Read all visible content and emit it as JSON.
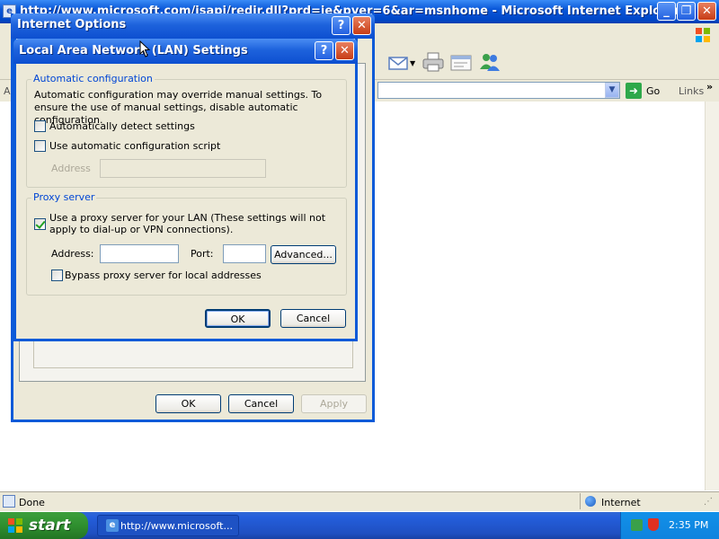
{
  "ie_window": {
    "title": "http://www.microsoft.com/isapi/redir.dll?prd=ie&pver=6&ar=msnhome - Microsoft Internet Explorer",
    "address_bar": {
      "label": "A",
      "go_label": "Go",
      "links_label": "Links",
      "chevron": "»"
    },
    "status_text": "Done",
    "zone_text": "Internet"
  },
  "internet_options": {
    "title": "Internet Options",
    "help_glyph": "?",
    "close_glyph": "✕",
    "buttons": {
      "ok": "OK",
      "cancel": "Cancel",
      "apply": "Apply"
    }
  },
  "lan_dialog": {
    "title": "Local Area Network (LAN) Settings",
    "help_glyph": "?",
    "close_glyph": "✕",
    "auto_config": {
      "legend": "Automatic configuration",
      "description": "Automatic configuration may override manual settings.  To ensure the use of manual settings, disable automatic configuration.",
      "auto_detect_label": "Automatically detect settings",
      "auto_detect_checked": false,
      "auto_script_label": "Use automatic configuration script",
      "auto_script_checked": false,
      "address_label": "Address",
      "address_value": ""
    },
    "proxy": {
      "legend": "Proxy server",
      "use_proxy_label": "Use a proxy server for your LAN (These settings will not apply to dial-up or VPN connections).",
      "use_proxy_checked": true,
      "address_label": "Address:",
      "address_value": "",
      "port_label": "Port:",
      "port_value": "",
      "advanced_label": "Advanced...",
      "bypass_label": "Bypass proxy server for local addresses",
      "bypass_checked": false
    },
    "buttons": {
      "ok": "OK",
      "cancel": "Cancel"
    }
  },
  "taskbar": {
    "start_label": "start",
    "task_label": "http://www.microsoft...",
    "clock": "2:35 PM"
  },
  "icons": {
    "ie_title_icon": "ie-page-icon",
    "minimize": "minimize-icon",
    "maximize": "maximize-icon",
    "close": "close-icon",
    "mail": "mail-icon",
    "print": "printer-icon",
    "edit": "edit-icon",
    "messenger": "messenger-icon",
    "xp_logo": "windows-flag-icon"
  }
}
